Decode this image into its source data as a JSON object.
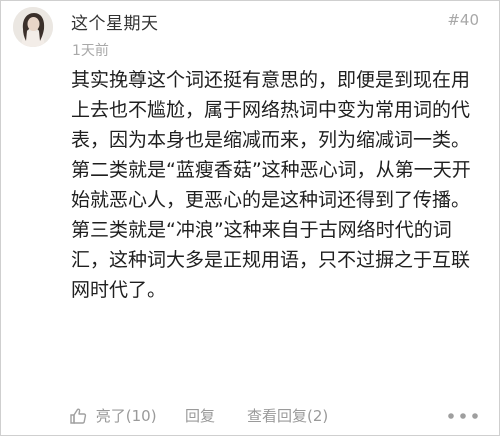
{
  "post": {
    "username": "这个星期天",
    "floor": "#40",
    "time": "1天前",
    "paragraphs": [
      "其实挽尊这个词还挺有意思的，即便是到现在用上去也不尴尬，属于网络热词中变为常用词的代表，因为本身也是缩减而来，列为缩减词一类。",
      "第二类就是“蓝瘦香菇”这种恶心词，从第一天开始就恶心人，更恶心的是这种词还得到了传播。",
      "第三类就是“冲浪”这种来自于古网络时代的词汇，这种词大多是正规用语，只不过摒之于互联网时代了。"
    ]
  },
  "actions": {
    "like_label": "亮了(10)",
    "reply_label": "回复",
    "view_replies_label": "查看回复(2)"
  },
  "icons": {
    "like": "thumbs-up-icon",
    "more": "more-dots-icon",
    "avatar": "user-avatar"
  },
  "colors": {
    "muted": "#9a9a9a",
    "text": "#1f1f1f"
  }
}
